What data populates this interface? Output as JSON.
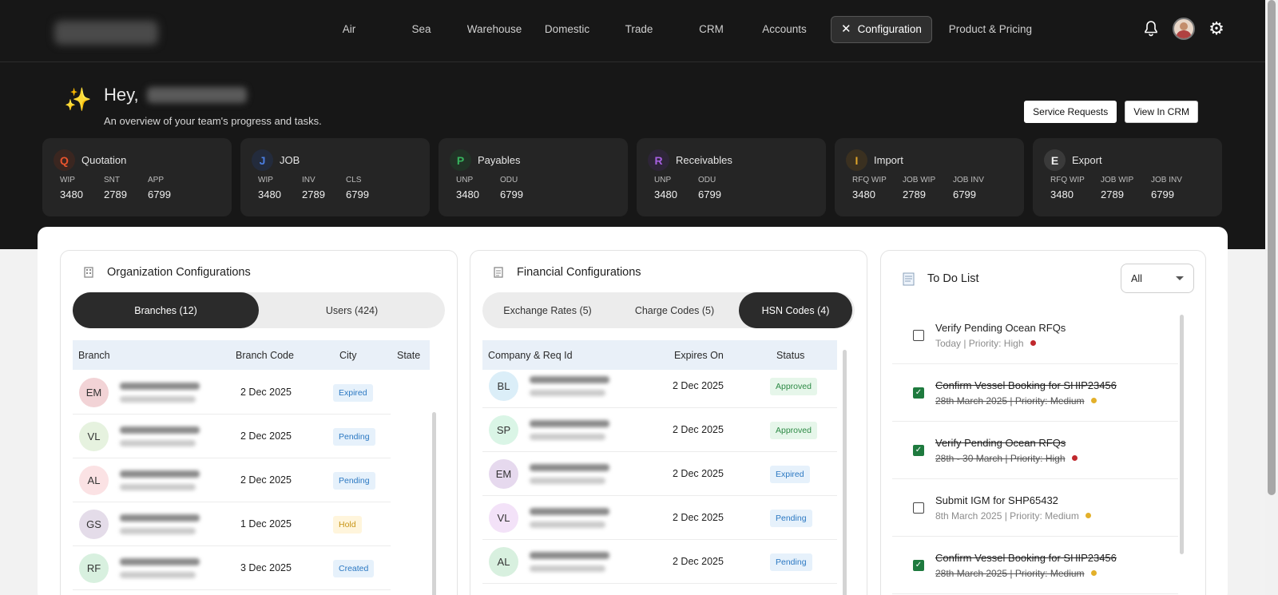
{
  "nav": {
    "items": [
      {
        "label": "Air"
      },
      {
        "label": "Sea"
      },
      {
        "label": "Warehouse"
      },
      {
        "label": "Domestic"
      },
      {
        "label": "Trade"
      },
      {
        "label": "CRM"
      },
      {
        "label": "Accounts"
      },
      {
        "label": "Configuration"
      },
      {
        "label": "Product & Pricing"
      }
    ]
  },
  "greeting": {
    "hey": "Hey,",
    "subtitle": "An overview of your team's progress and tasks."
  },
  "buttons": {
    "service_requests": "Service Requests",
    "view_in_crm": "View In CRM"
  },
  "stats": [
    {
      "letter": "Q",
      "title": "Quotation",
      "color": "#e8542d",
      "bg": "#3a2620",
      "metrics": [
        {
          "label": "WIP",
          "value": "3480"
        },
        {
          "label": "SNT",
          "value": "2789"
        },
        {
          "label": "APP",
          "value": "6799"
        }
      ]
    },
    {
      "letter": "J",
      "title": "JOB",
      "color": "#4a7de0",
      "bg": "#232b3c",
      "metrics": [
        {
          "label": "WIP",
          "value": "3480"
        },
        {
          "label": "INV",
          "value": "2789"
        },
        {
          "label": "CLS",
          "value": "6799"
        }
      ]
    },
    {
      "letter": "P",
      "title": "Payables",
      "color": "#37b35d",
      "bg": "#213326",
      "metrics": [
        {
          "label": "UNP",
          "value": "3480"
        },
        {
          "label": "ODU",
          "value": "6799"
        }
      ]
    },
    {
      "letter": "R",
      "title": "Receivables",
      "color": "#a760e0",
      "bg": "#2e2538",
      "metrics": [
        {
          "label": "UNP",
          "value": "3480"
        },
        {
          "label": "ODU",
          "value": "6799"
        }
      ]
    },
    {
      "letter": "I",
      "title": "Import",
      "color": "#e0a52a",
      "bg": "#3a3020",
      "metrics": [
        {
          "label": "RFQ WIP",
          "value": "3480"
        },
        {
          "label": "JOB WIP",
          "value": "2789"
        },
        {
          "label": "JOB INV",
          "value": "6799"
        }
      ]
    },
    {
      "letter": "E",
      "title": "Export",
      "color": "#f0f0f0",
      "bg": "#3a3a3a",
      "metrics": [
        {
          "label": "RFQ WIP",
          "value": "3480"
        },
        {
          "label": "JOB WIP",
          "value": "2789"
        },
        {
          "label": "JOB INV",
          "value": "6799"
        }
      ]
    }
  ],
  "org": {
    "title": "Organization Configurations",
    "tabs": [
      {
        "label": "Branches (12)"
      },
      {
        "label": "Users (424)"
      }
    ],
    "columns": {
      "c1": "Branch",
      "c2": "Branch Code",
      "c3": "City",
      "c4": "State"
    },
    "rows": [
      {
        "initials": "EM",
        "avatar_bg": "#f2d3d6",
        "date": "2 Dec 2025",
        "status": "Expired",
        "kind": "expired"
      },
      {
        "initials": "VL",
        "avatar_bg": "#e6f2df",
        "date": "2 Dec 2025",
        "status": "Pending",
        "kind": "pending"
      },
      {
        "initials": "AL",
        "avatar_bg": "#fbe2e4",
        "date": "2 Dec 2025",
        "status": "Pending",
        "kind": "pending"
      },
      {
        "initials": "GS",
        "avatar_bg": "#e4dce9",
        "date": "1 Dec 2025",
        "status": "Hold",
        "kind": "hold"
      },
      {
        "initials": "RF",
        "avatar_bg": "#d8f0df",
        "date": "3 Dec 2025",
        "status": "Created",
        "kind": "created"
      }
    ]
  },
  "fin": {
    "title": "Financial Configurations",
    "tabs": [
      {
        "label": "Exchange Rates (5)"
      },
      {
        "label": "Charge Codes (5)"
      },
      {
        "label": "HSN Codes (4)"
      }
    ],
    "columns": {
      "c1": "Company & Req Id",
      "c2": "Expires On",
      "c3": "Status"
    },
    "rows": [
      {
        "initials": "BL",
        "avatar_bg": "#dbeef8",
        "date": "2 Dec 2025",
        "status": "Approved",
        "kind": "approved"
      },
      {
        "initials": "SP",
        "avatar_bg": "#daf5e6",
        "date": "2 Dec 2025",
        "status": "Approved",
        "kind": "approved"
      },
      {
        "initials": "EM",
        "avatar_bg": "#e6d9ee",
        "date": "2 Dec 2025",
        "status": "Expired",
        "kind": "expired"
      },
      {
        "initials": "VL",
        "avatar_bg": "#f3e2f8",
        "date": "2 Dec 2025",
        "status": "Pending",
        "kind": "pending"
      },
      {
        "initials": "AL",
        "avatar_bg": "#d8f0df",
        "date": "2 Dec 2025",
        "status": "Pending",
        "kind": "pending"
      }
    ]
  },
  "todo": {
    "title": "To Do List",
    "filter": "All",
    "items": [
      {
        "title": "Verify Pending Ocean RFQs",
        "sub": "Today | Priority: High",
        "done": false,
        "dot": "#c0282d"
      },
      {
        "title": "Confirm Vessel Booking for SHIP23456",
        "sub": "28th March 2025 | Priority: Medium",
        "done": true,
        "dot": "#e3b02a"
      },
      {
        "title": "Verify Pending Ocean RFQs",
        "sub": "28th - 30 March | Priority: High",
        "done": true,
        "dot": "#c0282d"
      },
      {
        "title": "Submit IGM for SHP65432",
        "sub": "8th March 2025 | Priority: Medium",
        "done": false,
        "dot": "#e3b02a"
      },
      {
        "title": "Confirm Vessel Booking for SHIP23456",
        "sub": "28th March 2025 | Priority: Medium",
        "done": true,
        "dot": "#e3b02a"
      }
    ]
  }
}
